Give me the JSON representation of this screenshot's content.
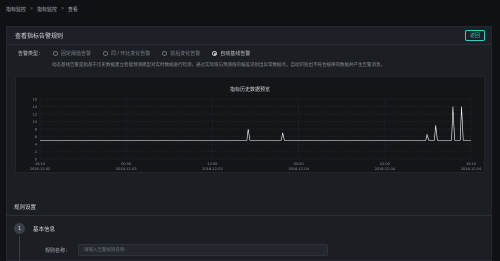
{
  "breadcrumb": {
    "items": [
      "指标监控",
      "指标监控",
      "查看"
    ]
  },
  "panel": {
    "title": "查看指标告警规则",
    "back_label": "返回"
  },
  "alarm_type": {
    "label": "告警类型：",
    "options": [
      {
        "label": "固定阈值告警",
        "checked": false
      },
      {
        "label": "同 / 环比变化告警",
        "checked": false
      },
      {
        "label": "前后变化告警",
        "checked": false
      },
      {
        "label": "自动基线告警",
        "checked": true
      }
    ],
    "description": "动态基线告警是指基于历史数据建立智能预测模型对实时数据进行检测，通过实际值与预测值的偏差识别出异常数据点，自动识别出不符合规律的数据并产生告警消息。"
  },
  "chart_data": {
    "type": "line",
    "title": "指标历史数据预览",
    "ylim": [
      0,
      16
    ],
    "yticks": [
      0,
      2,
      4,
      6,
      8,
      10,
      12,
      14,
      16
    ],
    "xticks": [
      {
        "time": "15:10",
        "date": "2018-12-02"
      },
      {
        "time": "00:00",
        "date": "2018-12-03"
      },
      {
        "time": "12:00",
        "date": "2018-12-03"
      },
      {
        "time": "00:00",
        "date": "2018-12-04"
      },
      {
        "time": "12:00",
        "date": "2018-12-04"
      },
      {
        "time": "15:10",
        "date": "2018-12-04"
      }
    ],
    "grid": true,
    "series": [
      {
        "color": "#ffffff",
        "values": [
          [
            0,
            5
          ],
          [
            0.48,
            5
          ],
          [
            0.483,
            8
          ],
          [
            0.487,
            5
          ],
          [
            0.56,
            5
          ],
          [
            0.563,
            7
          ],
          [
            0.567,
            5
          ],
          [
            0.895,
            5
          ],
          [
            0.898,
            6.5
          ],
          [
            0.902,
            5
          ],
          [
            0.915,
            5
          ],
          [
            0.918,
            9
          ],
          [
            0.922,
            5
          ],
          [
            0.955,
            5
          ],
          [
            0.958,
            14
          ],
          [
            0.962,
            5
          ],
          [
            0.975,
            5
          ],
          [
            0.978,
            14
          ],
          [
            0.982,
            5
          ],
          [
            1,
            5
          ]
        ]
      }
    ]
  },
  "rules": {
    "section_title": "规则设置",
    "step_number": "1",
    "step_title": "基本信息",
    "rule_name_label": "规则名称：",
    "rule_name_placeholder": "请输入告警规则名称"
  },
  "colors": {
    "accent": "#2fd0c8",
    "background": "#0f1114",
    "panel": "#1b1e23"
  }
}
